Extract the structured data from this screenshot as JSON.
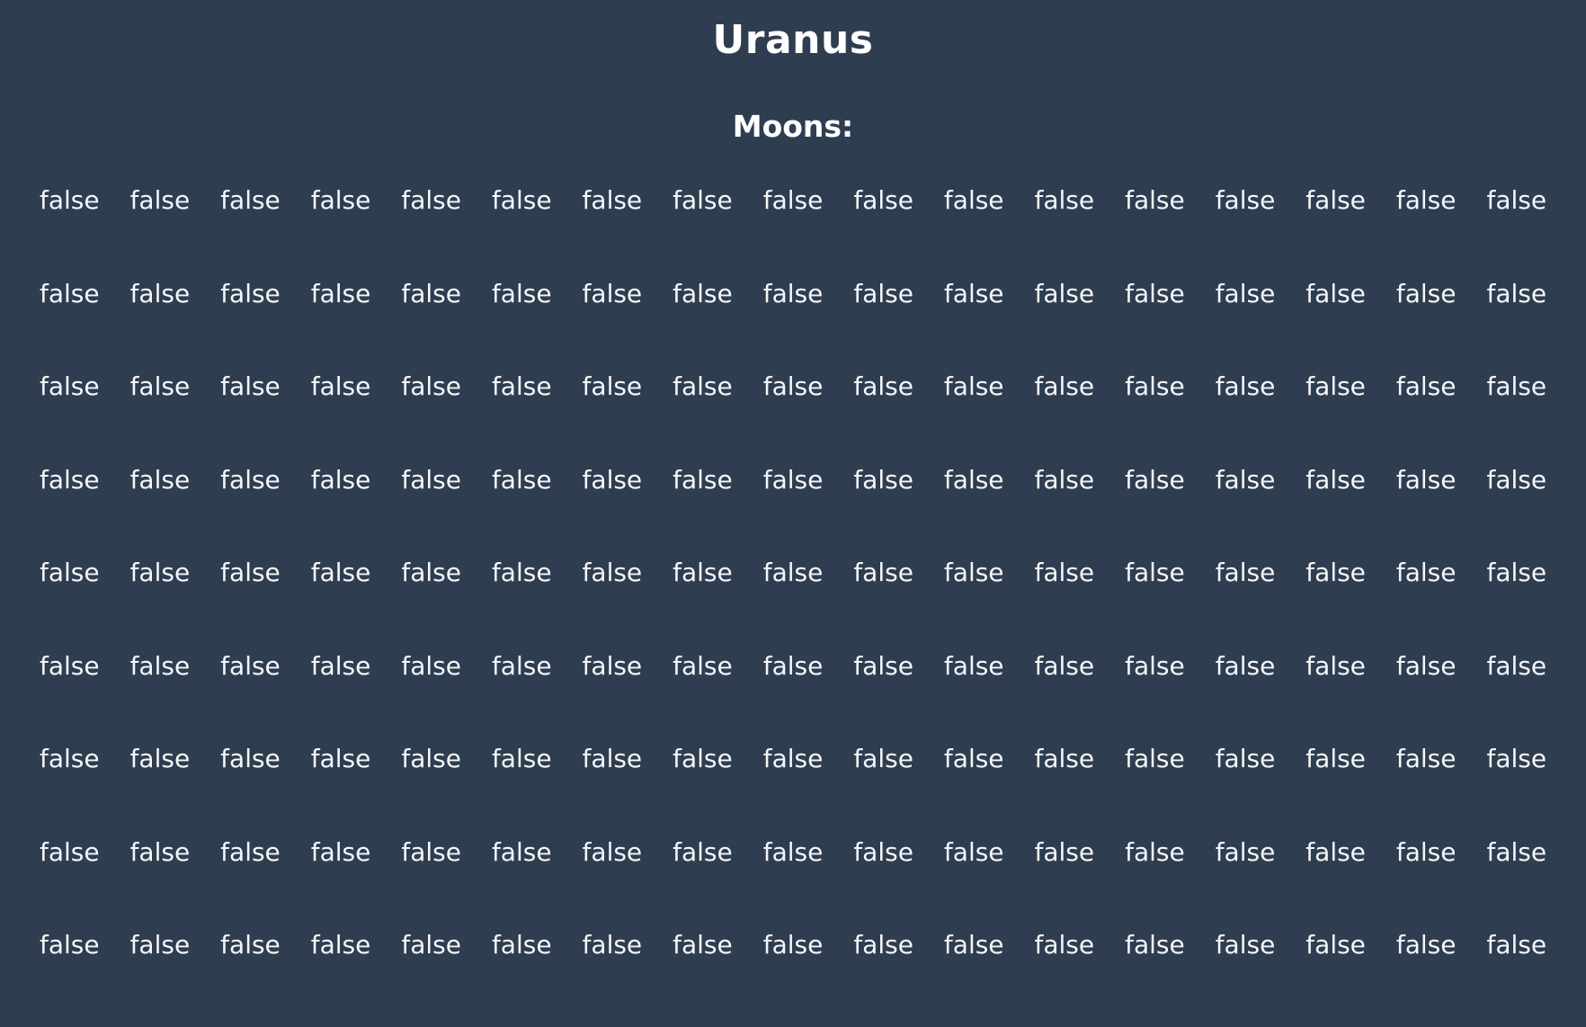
{
  "planet": {
    "name": "Uranus"
  },
  "moons": {
    "heading": "Moons:",
    "columns": 17,
    "values": [
      "false",
      "false",
      "false",
      "false",
      "false",
      "false",
      "false",
      "false",
      "false",
      "false",
      "false",
      "false",
      "false",
      "false",
      "false",
      "false",
      "false",
      "false",
      "false",
      "false",
      "false",
      "false",
      "false",
      "false",
      "false",
      "false",
      "false",
      "false",
      "false",
      "false",
      "false",
      "false",
      "false",
      "false",
      "false",
      "false",
      "false",
      "false",
      "false",
      "false",
      "false",
      "false",
      "false",
      "false",
      "false",
      "false",
      "false",
      "false",
      "false",
      "false",
      "false",
      "false",
      "false",
      "false",
      "false",
      "false",
      "false",
      "false",
      "false",
      "false",
      "false",
      "false",
      "false",
      "false",
      "false",
      "false",
      "false",
      "false",
      "false",
      "false",
      "false",
      "false",
      "false",
      "false",
      "false",
      "false",
      "false",
      "false",
      "false",
      "false",
      "false",
      "false",
      "false",
      "false",
      "false",
      "false",
      "false",
      "false",
      "false",
      "false",
      "false",
      "false",
      "false",
      "false",
      "false",
      "false",
      "false",
      "false",
      "false",
      "false",
      "false",
      "false",
      "false",
      "false",
      "false",
      "false",
      "false",
      "false",
      "false",
      "false",
      "false",
      "false",
      "false",
      "false",
      "false",
      "false",
      "false",
      "false",
      "false",
      "false",
      "false",
      "false",
      "false",
      "false",
      "false",
      "false",
      "false",
      "false",
      "false",
      "false",
      "false",
      "false",
      "false",
      "false",
      "false",
      "false",
      "false",
      "false",
      "false",
      "false",
      "false",
      "false",
      "false",
      "false",
      "false",
      "false",
      "false",
      "false",
      "false",
      "false",
      "false",
      "false",
      "false"
    ]
  },
  "colors": {
    "background": "#2f3d50",
    "text": "#ffffff"
  }
}
